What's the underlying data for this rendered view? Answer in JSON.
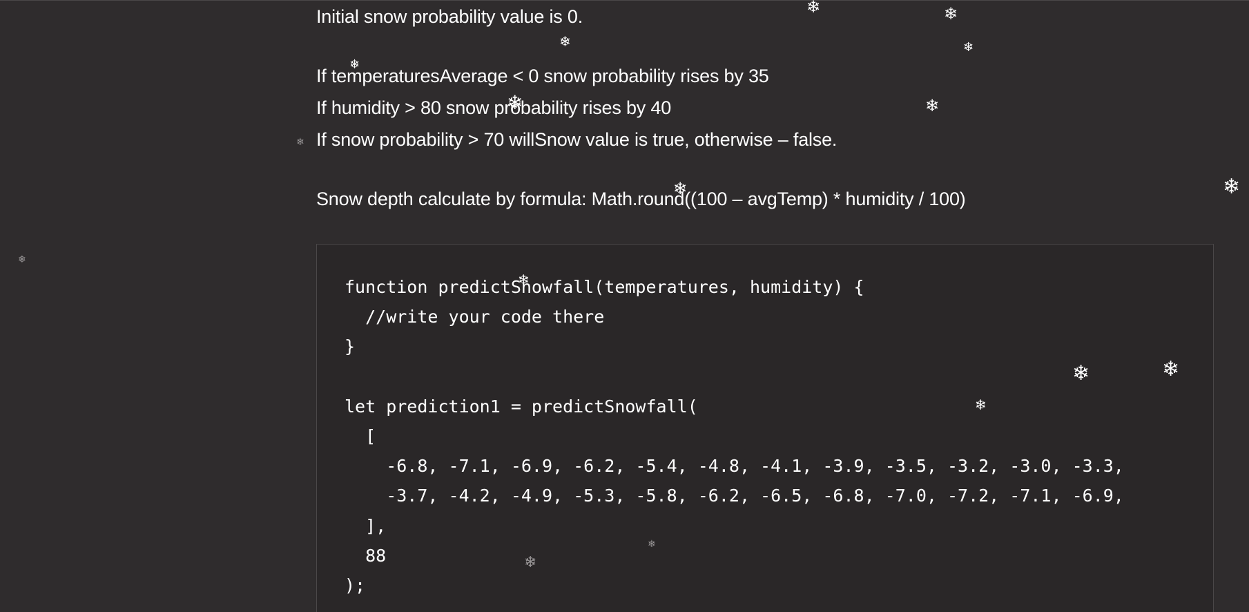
{
  "rules": {
    "initial": "Initial snow probability value is 0.",
    "temperature_rule": "If temperaturesAverage < 0 snow probability rises by 35",
    "humidity_rule": "If humidity > 80 snow probability rises by 40",
    "will_snow_rule": "If snow probability > 70 willSnow value is true, otherwise – false.",
    "depth_formula": "Snow depth calculate by formula: Math.round((100 – avgTemp) * humidity / 100)"
  },
  "code": {
    "lines": [
      "function predictSnowfall(temperatures, humidity) {",
      "  //write your code there",
      "}",
      "",
      "let prediction1 = predictSnowfall(",
      "  [",
      "    -6.8, -7.1, -6.9, -6.2, -5.4, -4.8, -4.1, -3.9, -3.5, -3.2, -3.0, -3.3,",
      "    -3.7, -4.2, -4.9, -5.3, -5.8, -6.2, -6.5, -6.8, -7.0, -7.2, -7.1, -6.9,",
      "  ],",
      "  88",
      ");"
    ]
  },
  "decoration": {
    "snowflake_glyph": "❄",
    "snowflake_icon": "snowflake-icon"
  }
}
